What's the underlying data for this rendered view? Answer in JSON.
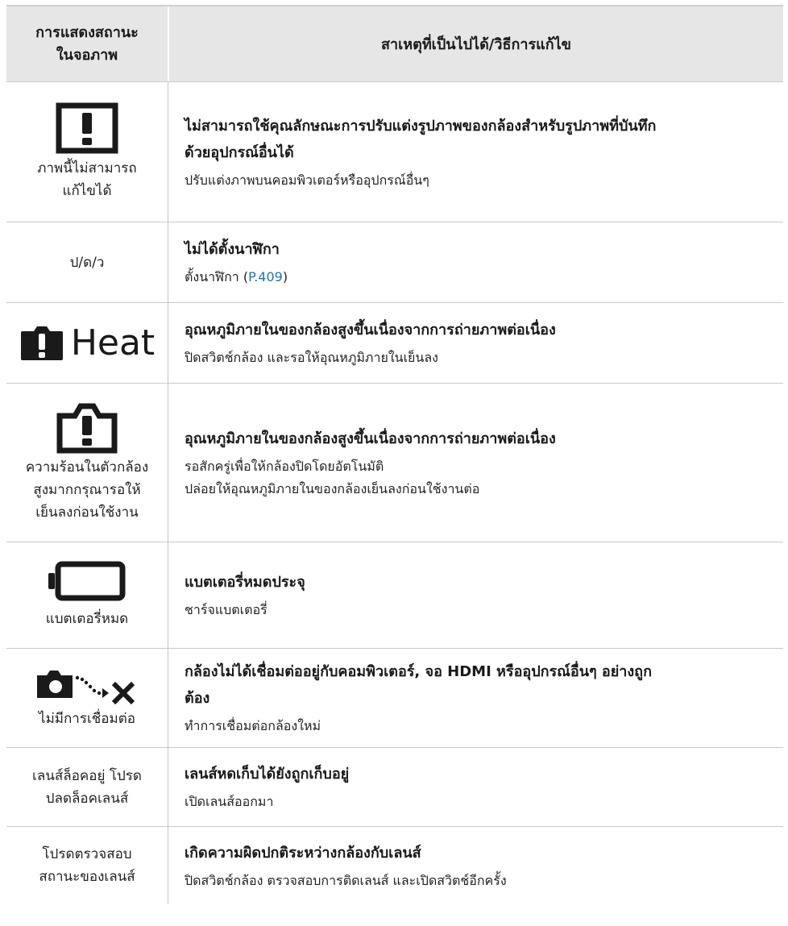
{
  "header": {
    "col1_line1": "การแสดงสถานะ",
    "col1_line2": "ในจอภาพ",
    "col2": "สาเหตุที่เป็นไปได้/วิธีการแก้ไข"
  },
  "rows": [
    {
      "icon": "warning-screen-icon",
      "display": [
        "ภาพนี้ไม่สามารถ",
        "แก้ไขได้"
      ],
      "cause": [
        "ไม่สามารถใช้คุณลักษณะการปรับแต่งรูปภาพของกล้องสำหรับรูปภาพที่บันทึก",
        "ด้วยอุปกรณ์อื่นได้"
      ],
      "fix": [
        "ปรับแต่งภาพบนคอมพิวเตอร์หรืออุปกรณ์อื่นๆ"
      ]
    },
    {
      "display": [
        "ป/ด/ว"
      ],
      "cause": [
        "ไม่ได้ตั้งนาฬิกา"
      ],
      "fix_prefix": "ตั้งนาฬิกา (",
      "fix_link": "P.409",
      "fix_suffix": ")"
    },
    {
      "icon": "heat-warning-icon",
      "heat_label": "Heat",
      "cause": [
        "อุณหภูมิภายในของกล้องสูงขึ้นเนื่องจากการถ่ายภาพต่อเนื่อง"
      ],
      "fix": [
        "ปิดสวิตช์กล้อง และรอให้อุณหภูมิภายในเย็นลง"
      ]
    },
    {
      "icon": "camera-warning-icon",
      "display": [
        "ความร้อนในตัวกล้อง",
        "สูงมากกรุณารอให้",
        "เย็นลงก่อนใช้งาน"
      ],
      "cause": [
        "อุณหภูมิภายในของกล้องสูงขึ้นเนื่องจากการถ่ายภาพต่อเนื่อง"
      ],
      "fix": [
        "รอสักครู่เพื่อให้กล้องปิดโดยอัตโนมัติ",
        "ปล่อยให้อุณหภูมิภายในของกล้องเย็นลงก่อนใช้งานต่อ"
      ]
    },
    {
      "icon": "battery-empty-icon",
      "display": [
        "แบตเตอรี่หมด"
      ],
      "cause": [
        "แบตเตอรี่หมดประจุ"
      ],
      "fix": [
        "ชาร์จแบตเตอรี่"
      ]
    },
    {
      "icon": "camera-disconnected-icon",
      "display": [
        "ไม่มีการเชื่อมต่อ"
      ],
      "cause": [
        "กล้องไม่ได้เชื่อมต่ออยู่กับคอมพิวเตอร์, จอ HDMI หรืออุปกรณ์อื่นๆ อย่างถูก",
        "ต้อง"
      ],
      "fix": [
        "ทำการเชื่อมต่อกล้องใหม่"
      ]
    },
    {
      "display": [
        "เลนส์ล็อคอยู่ โปรด",
        "ปลดล็อคเลนส์"
      ],
      "cause": [
        "เลนส์หดเก็บได้ยังถูกเก็บอยู่"
      ],
      "fix": [
        "เปิดเลนส์ออกมา"
      ]
    },
    {
      "display": [
        "โปรดตรวจสอบ",
        "สถานะของเลนส์"
      ],
      "cause": [
        "เกิดความผิดปกติระหว่างกล้องกับเลนส์"
      ],
      "fix": [
        "ปิดสวิตช์กล้อง ตรวจสอบการติดเลนส์ และเปิดสวิตช์อีกครั้ง"
      ]
    }
  ]
}
